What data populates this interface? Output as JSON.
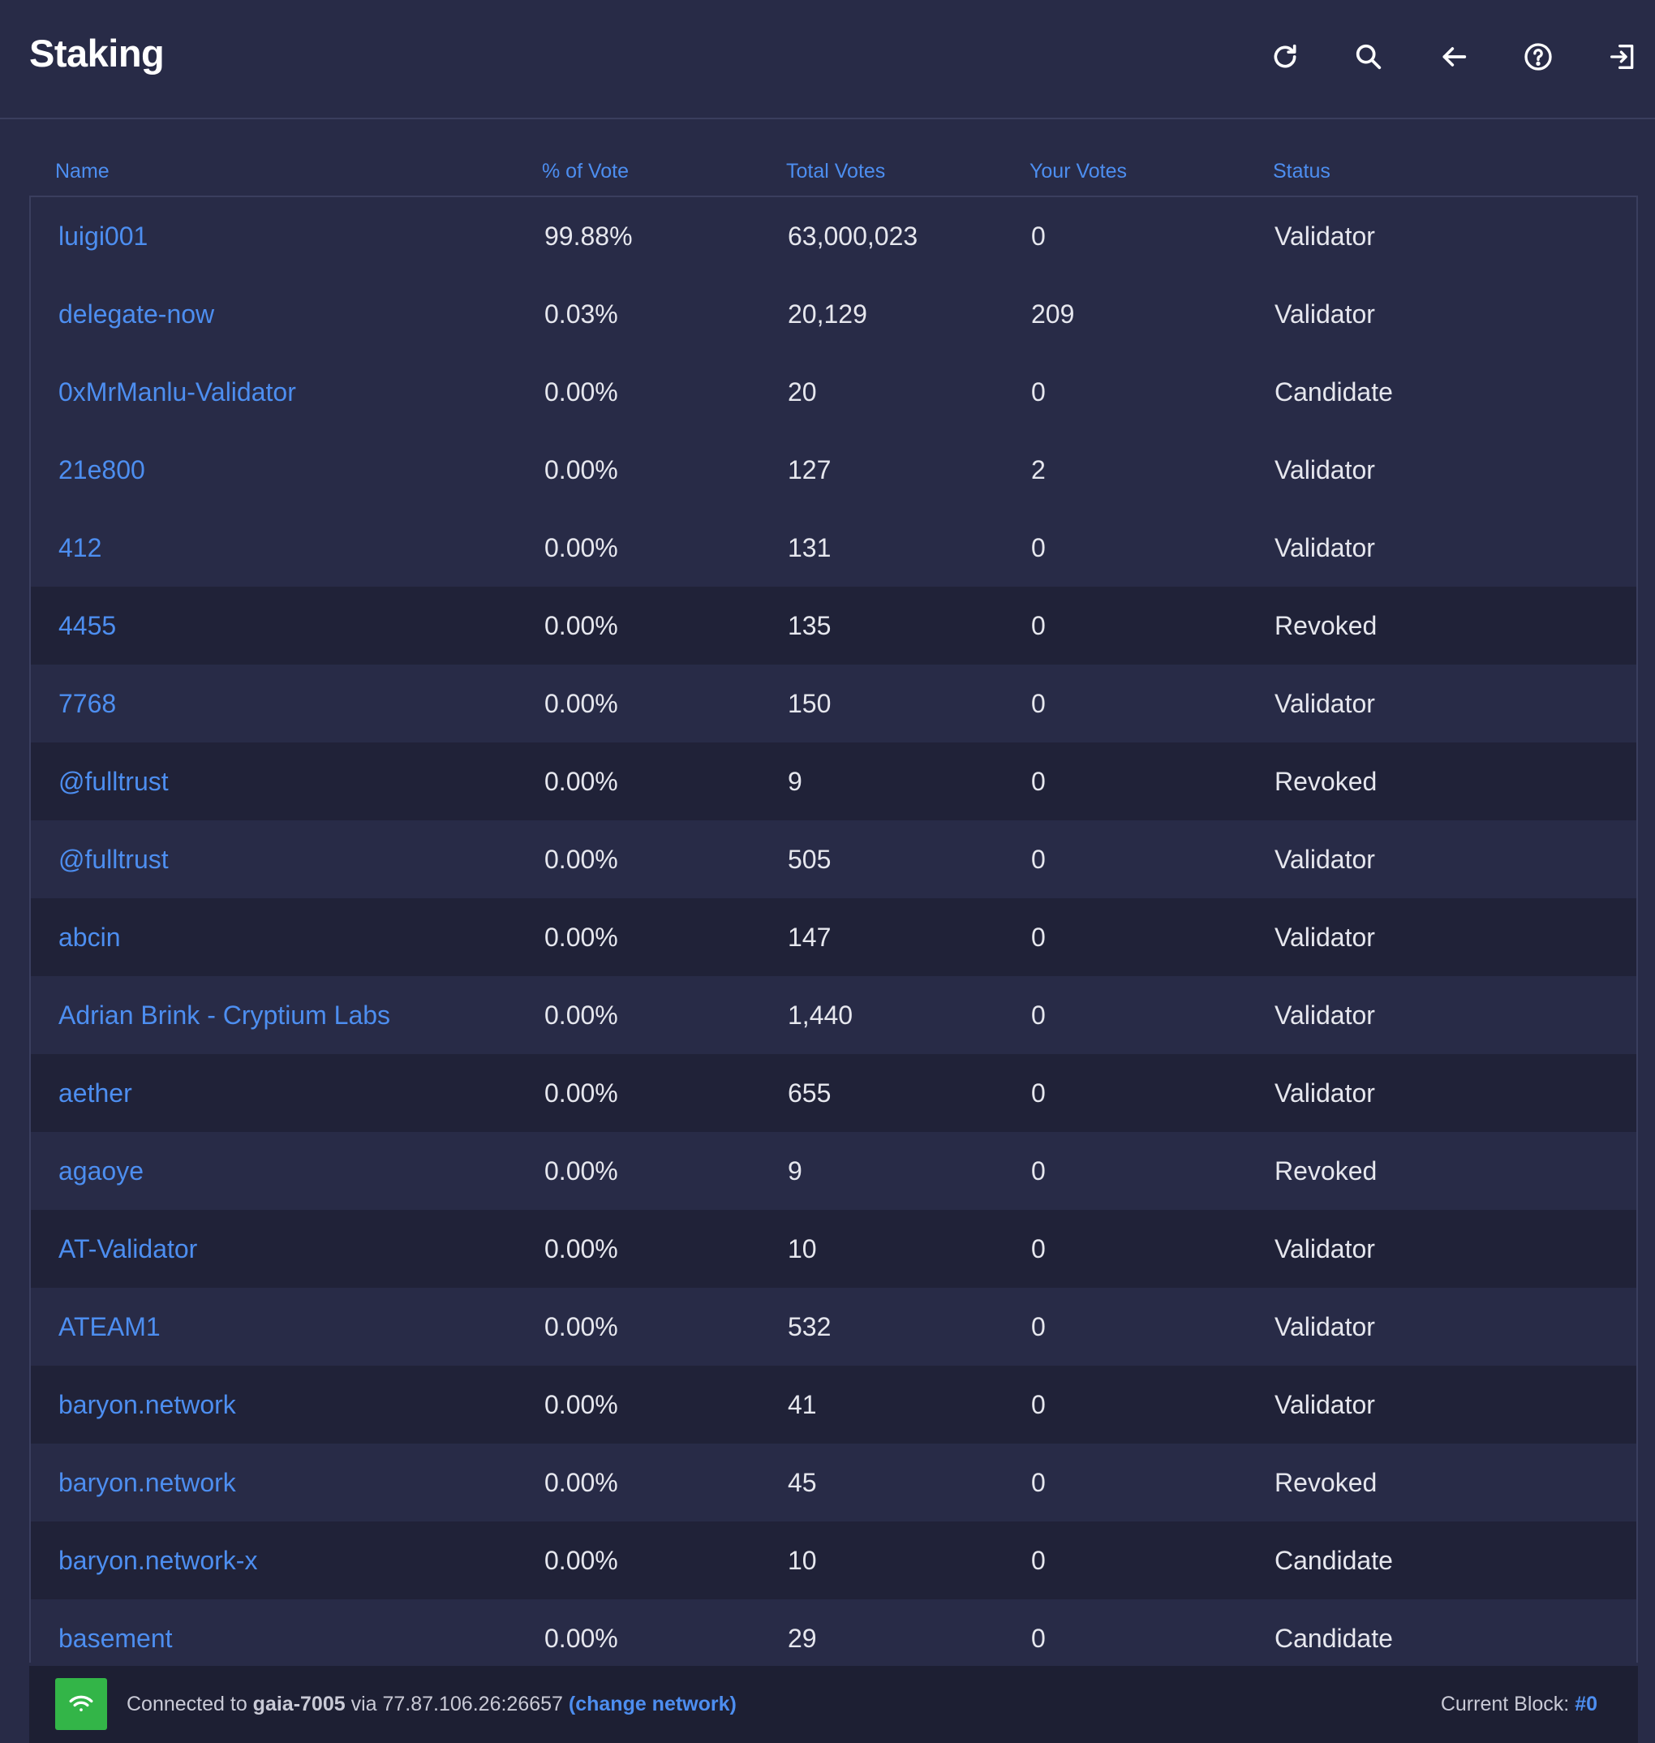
{
  "header": {
    "title": "Staking",
    "icons": [
      "refresh-icon",
      "search-icon",
      "back-arrow-icon",
      "help-icon",
      "sign-out-icon"
    ]
  },
  "table": {
    "columns": [
      "Name",
      "% of Vote",
      "Total Votes",
      "Your Votes",
      "Status"
    ],
    "rows": [
      {
        "name": "luigi001",
        "vote_pct": "99.88%",
        "total_votes": "63,000,023",
        "your_votes": "0",
        "status": "Validator"
      },
      {
        "name": "delegate-now",
        "vote_pct": "0.03%",
        "total_votes": "20,129",
        "your_votes": "209",
        "status": "Validator"
      },
      {
        "name": "0xMrManlu-Validator",
        "vote_pct": "0.00%",
        "total_votes": "20",
        "your_votes": "0",
        "status": "Candidate"
      },
      {
        "name": "21e800",
        "vote_pct": "0.00%",
        "total_votes": "127",
        "your_votes": "2",
        "status": "Validator"
      },
      {
        "name": "412",
        "vote_pct": "0.00%",
        "total_votes": "131",
        "your_votes": "0",
        "status": "Validator"
      },
      {
        "name": "4455",
        "vote_pct": "0.00%",
        "total_votes": "135",
        "your_votes": "0",
        "status": "Revoked"
      },
      {
        "name": "7768",
        "vote_pct": "0.00%",
        "total_votes": "150",
        "your_votes": "0",
        "status": "Validator"
      },
      {
        "name": "@fulltrust",
        "vote_pct": "0.00%",
        "total_votes": "9",
        "your_votes": "0",
        "status": "Revoked"
      },
      {
        "name": "@fulltrust",
        "vote_pct": "0.00%",
        "total_votes": "505",
        "your_votes": "0",
        "status": "Validator"
      },
      {
        "name": "abcin",
        "vote_pct": "0.00%",
        "total_votes": "147",
        "your_votes": "0",
        "status": "Validator"
      },
      {
        "name": "Adrian Brink - Cryptium Labs",
        "vote_pct": "0.00%",
        "total_votes": "1,440",
        "your_votes": "0",
        "status": "Validator"
      },
      {
        "name": "aether",
        "vote_pct": "0.00%",
        "total_votes": "655",
        "your_votes": "0",
        "status": "Validator"
      },
      {
        "name": "agaoye",
        "vote_pct": "0.00%",
        "total_votes": "9",
        "your_votes": "0",
        "status": "Revoked"
      },
      {
        "name": "AT-Validator",
        "vote_pct": "0.00%",
        "total_votes": "10",
        "your_votes": "0",
        "status": "Validator"
      },
      {
        "name": "ATEAM1",
        "vote_pct": "0.00%",
        "total_votes": "532",
        "your_votes": "0",
        "status": "Validator"
      },
      {
        "name": "baryon.network",
        "vote_pct": "0.00%",
        "total_votes": "41",
        "your_votes": "0",
        "status": "Validator"
      },
      {
        "name": "baryon.network",
        "vote_pct": "0.00%",
        "total_votes": "45",
        "your_votes": "0",
        "status": "Revoked"
      },
      {
        "name": "baryon.network-x",
        "vote_pct": "0.00%",
        "total_votes": "10",
        "your_votes": "0",
        "status": "Candidate"
      },
      {
        "name": "basement",
        "vote_pct": "0.00%",
        "total_votes": "29",
        "your_votes": "0",
        "status": "Candidate"
      }
    ]
  },
  "footer": {
    "connected_prefix": "Connected to",
    "network": "gaia-7005",
    "via_text": "via 77.87.106.26:26657",
    "change_network": "(change network)",
    "current_block_label": "Current Block:",
    "current_block_value": "#0"
  },
  "colors": {
    "background": "#282b47",
    "row_dark": "#202238",
    "footer_bg": "#1d1f33",
    "accent_blue": "#4d8ef0",
    "connected_green": "#33b548"
  }
}
